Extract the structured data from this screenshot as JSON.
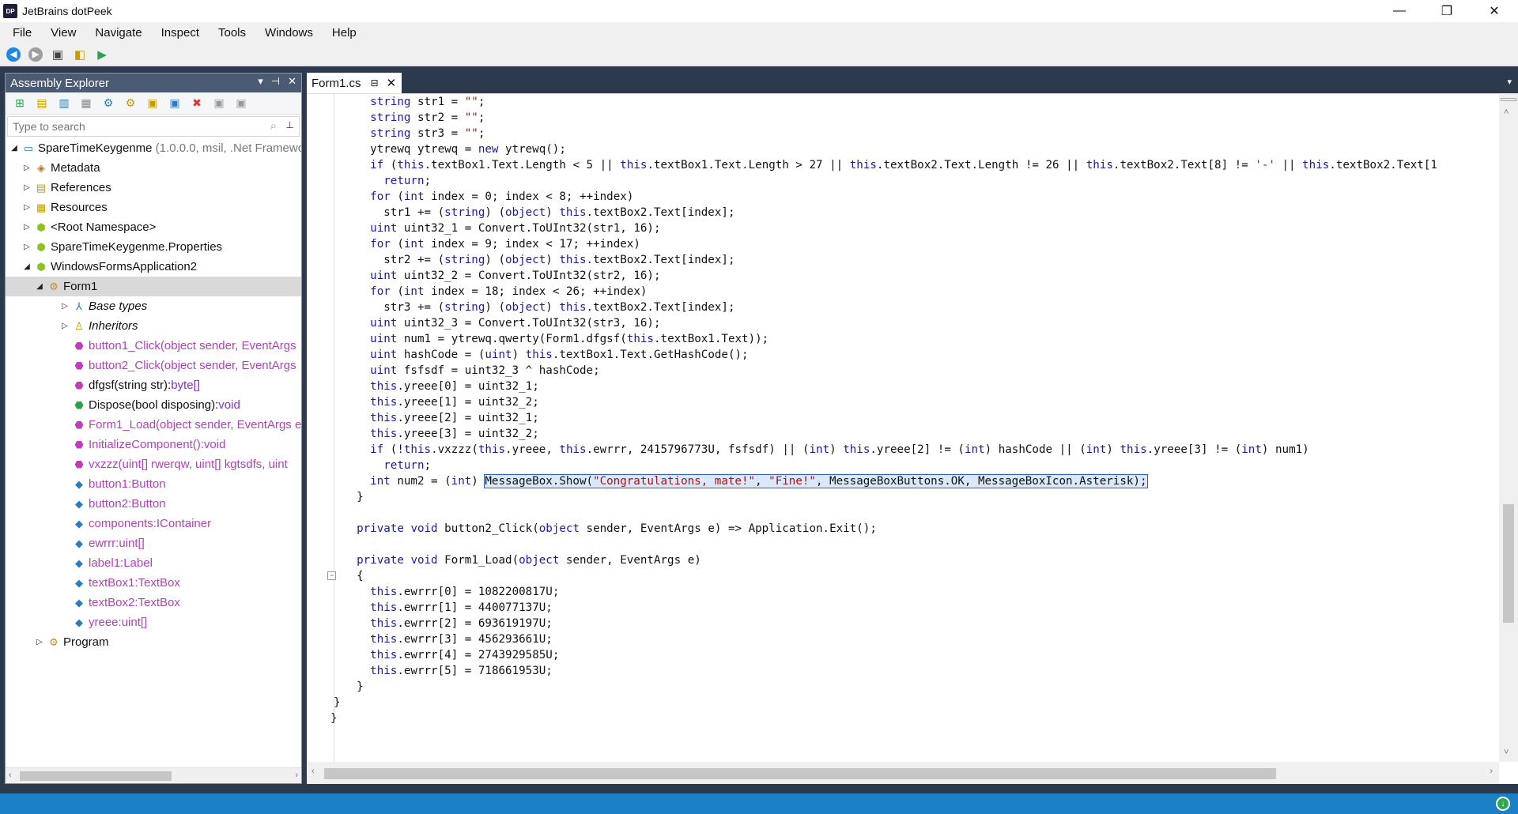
{
  "window": {
    "title": "JetBrains dotPeek",
    "app_icon": "DP",
    "min": "—",
    "max": "❐",
    "close": "✕"
  },
  "menu": [
    "File",
    "View",
    "Navigate",
    "Inspect",
    "Tools",
    "Windows",
    "Help"
  ],
  "explorer": {
    "title": "Assembly Explorer",
    "search_placeholder": "Type to search",
    "tree": [
      {
        "label": "SpareTimeKeygenme",
        "dim": " (1.0.0.0, msil, .Net Framewo",
        "icon": "assembly-icon",
        "purple": false
      },
      {
        "label": "Metadata",
        "icon": "metadata-icon"
      },
      {
        "label": "References",
        "icon": "references-icon"
      },
      {
        "label": "Resources",
        "icon": "resources-icon"
      },
      {
        "label": "<Root Namespace>",
        "icon": "namespace-icon"
      },
      {
        "label": "SpareTimeKeygenme.Properties",
        "icon": "namespace-icon"
      },
      {
        "label": "WindowsFormsApplication2",
        "icon": "namespace-icon"
      },
      {
        "label": "Form1",
        "icon": "class-icon"
      },
      {
        "label": "Base types",
        "icon": "base-types-icon"
      },
      {
        "label": "Inheritors",
        "icon": "inheritors-icon"
      },
      {
        "label": "button1_Click(object sender, EventArgs",
        "icon": "method-icon"
      },
      {
        "label": "button2_Click(object sender, EventArgs",
        "icon": "method-icon"
      },
      {
        "label": "dfgsf(string str):",
        "kw": "byte[]",
        "icon": "method-icon"
      },
      {
        "label": "Dispose(bool disposing):",
        "kw": "void",
        "icon": "method-icon"
      },
      {
        "label": "Form1_Load(object sender, EventArgs e)",
        "icon": "method-icon"
      },
      {
        "label": "InitializeComponent():void",
        "icon": "method-icon"
      },
      {
        "label": "vxzzz(uint[] rwerqw, uint[] kgtsdfs, uint",
        "icon": "method-icon"
      },
      {
        "label": "button1:Button",
        "icon": "field-icon"
      },
      {
        "label": "button2:Button",
        "icon": "field-icon"
      },
      {
        "label": "components:IContainer",
        "icon": "field-icon"
      },
      {
        "label": "ewrrr:uint[]",
        "icon": "field-icon"
      },
      {
        "label": "label1:Label",
        "icon": "field-icon"
      },
      {
        "label": "textBox1:TextBox",
        "icon": "field-icon"
      },
      {
        "label": "textBox2:TextBox",
        "icon": "field-icon"
      },
      {
        "label": "yreee:uint[]",
        "icon": "field-icon"
      },
      {
        "label": "Program",
        "icon": "class-icon"
      }
    ]
  },
  "editor": {
    "tab_label": "Form1.cs",
    "code": [
      "    string str1 = \"\";",
      "    string str2 = \"\";",
      "    string str3 = \"\";",
      "    ytrewq ytrewq = new ytrewq();",
      "    if (this.textBox1.Text.Length < 5 || this.textBox1.Text.Length > 27 || this.textBox2.Text.Length != 26 || this.textBox2.Text[8] != '-' || this.textBox2.Text[1",
      "      return;",
      "    for (int index = 0; index < 8; ++index)",
      "      str1 += (string) (object) this.textBox2.Text[index];",
      "    uint uint32_1 = Convert.ToUInt32(str1, 16);",
      "    for (int index = 9; index < 17; ++index)",
      "      str2 += (string) (object) this.textBox2.Text[index];",
      "    uint uint32_2 = Convert.ToUInt32(str2, 16);",
      "    for (int index = 18; index < 26; ++index)",
      "      str3 += (string) (object) this.textBox2.Text[index];",
      "    uint uint32_3 = Convert.ToUInt32(str3, 16);",
      "    uint num1 = ytrewq.qwerty(Form1.dfgsf(this.textBox1.Text));",
      "    uint hashCode = (uint) this.textBox1.Text.GetHashCode();",
      "    uint fsfsdf = uint32_3 ^ hashCode;",
      "    this.yreee[0] = uint32_1;",
      "    this.yreee[1] = uint32_2;",
      "    this.yreee[2] = uint32_1;",
      "    this.yreee[3] = uint32_2;",
      "    if (!this.vxzzz(this.yreee, this.ewrrr, 2415796773U, fsfsdf) || (int) this.yreee[2] != (int) hashCode || (int) this.yreee[3] != (int) num1)",
      "      return;",
      "    int num2 = (int) MessageBox.Show(\"Congratulations, mate!\", \"Fine!\", MessageBoxButtons.OK, MessageBoxIcon.Asterisk);",
      "  }",
      "",
      "  private void button2_Click(object sender, EventArgs e) => Application.Exit();",
      "",
      "  private void Form1_Load(object sender, EventArgs e)",
      "  {",
      "    this.ewrrr[0] = 1082200817U;",
      "    this.ewrrr[1] = 440077137U;",
      "    this.ewrrr[2] = 693619197U;",
      "    this.ewrrr[3] = 456293661U;",
      "    this.ewrrr[4] = 2743929585U;",
      "    this.ewrrr[5] = 718661953U;",
      "  }",
      "}",
      "}"
    ]
  }
}
